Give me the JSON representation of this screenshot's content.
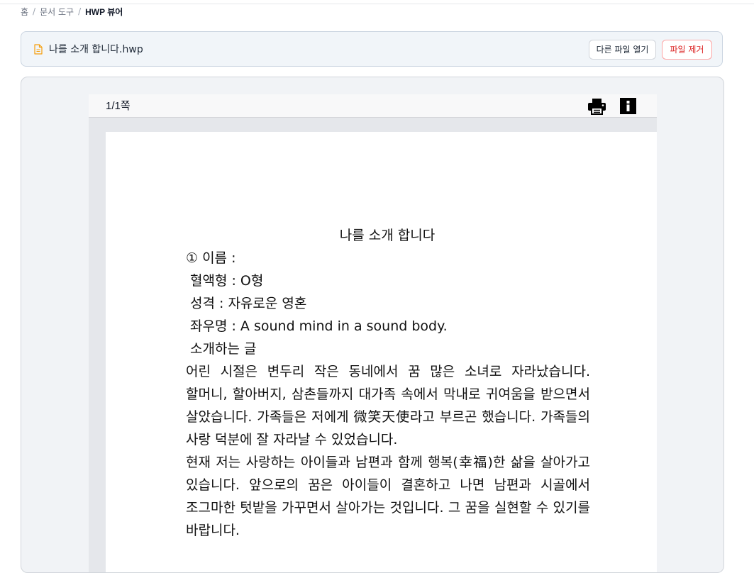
{
  "breadcrumb": {
    "home": "홈",
    "section": "문서 도구",
    "current": "HWP 뷰어",
    "separator": "/"
  },
  "file_bar": {
    "file_name": "나를 소개 합니다.hwp",
    "icon": "document-icon",
    "open_other_label": "다른 파일 열기",
    "remove_label": "파일 제거"
  },
  "viewer": {
    "page_indicator": "1/1쪽",
    "print_icon": "print-icon",
    "info_icon": "info-icon"
  },
  "document": {
    "title": "나를 소개 합니다",
    "lines": [
      "① 이름 :",
      "혈액형 : O형",
      "성격 : 자유로운 영혼",
      "좌우명 : A sound mind in a sound body.",
      "소개하는 글"
    ],
    "paragraph1": "어린 시절은 변두리 작은 동네에서 꿈 많은 소녀로 자라났습니다. 할머니, 할아버지, 삼촌들까지 대가족 속에서 막내로 귀여움을 받으면서 살았습니다. 가족들은 저에게 微笑天使라고 부르곤 했습니다. 가족들의 사랑 덕분에 잘 자라날 수 있었습니다.",
    "paragraph2": "현재 저는 사랑하는 아이들과 남편과 함께 행복(幸福)한 삶을 살아가고 있습니다. 앞으로의 꿈은 아이들이 결혼하고 나면 남편과 시골에서 조그마한 텃밭을 가꾸면서 살아가는 것입니다. 그 꿈을 실현할 수 있기를 바랍니다."
  },
  "colors": {
    "accent_danger": "#dc2626",
    "file_bar_bg": "#f1f5f9",
    "viewer_bg": "#e5e7eb"
  }
}
